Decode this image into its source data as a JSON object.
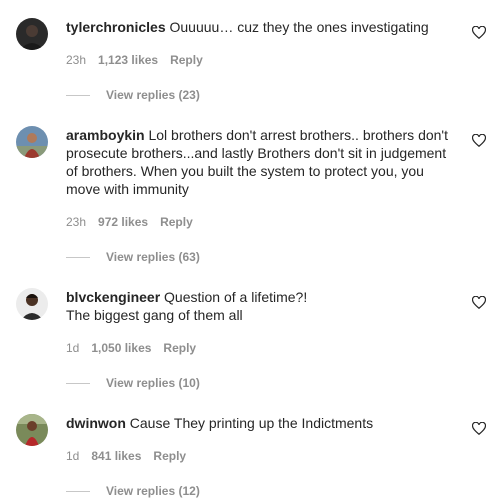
{
  "comments": [
    {
      "username": "tylerchronicles",
      "text": "Ouuuuu… cuz they the ones investigating",
      "time": "23h",
      "likes": "1,123 likes",
      "reply_label": "Reply",
      "view_replies": "View replies (23)"
    },
    {
      "username": "aramboykin",
      "text": "Lol brothers don't arrest brothers.. brothers don't prosecute brothers...and lastly Brothers don't sit in judgement of brothers. When you built the system to protect you, you move with immunity",
      "time": "23h",
      "likes": "972 likes",
      "reply_label": "Reply",
      "view_replies": "View replies (63)"
    },
    {
      "username": "blvckengineer",
      "text": "Question of a lifetime?!\nThe biggest gang of them all",
      "time": "1d",
      "likes": "1,050 likes",
      "reply_label": "Reply",
      "view_replies": "View replies (10)"
    },
    {
      "username": "dwinwon",
      "text": "Cause They printing up the Indictments",
      "time": "1d",
      "likes": "841 likes",
      "reply_label": "Reply",
      "view_replies": "View replies (12)"
    }
  ],
  "icons": {
    "like": "heart-outline-icon"
  },
  "colors": {
    "text": "#262626",
    "secondary": "#8e8e8e",
    "divider": "#c7c7c7"
  }
}
